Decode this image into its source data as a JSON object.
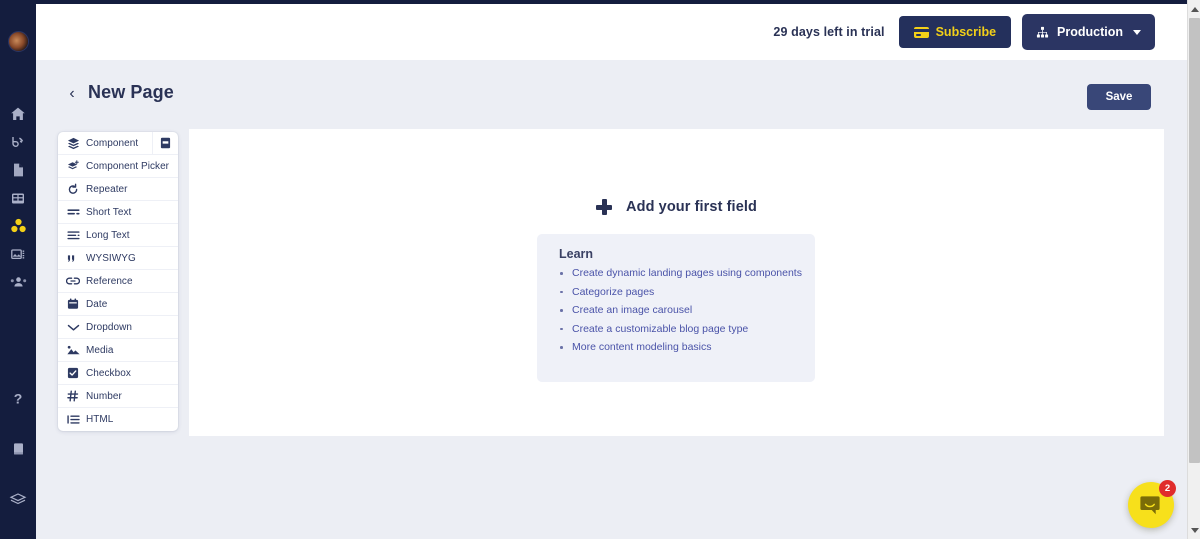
{
  "topbar": {
    "trial_text": "29 days left in trial",
    "subscribe_label": "Subscribe",
    "environment_label": "Production"
  },
  "page_header": {
    "back_label": "‹",
    "title": "New Page",
    "save_label": "Save"
  },
  "field_types": {
    "library_button_title": "Component library",
    "items": [
      {
        "label": "Component",
        "icon": "layers-icon"
      },
      {
        "label": "Component Picker",
        "icon": "layers-plus-icon"
      },
      {
        "label": "Repeater",
        "icon": "refresh-icon"
      },
      {
        "label": "Short Text",
        "icon": "short-text-icon"
      },
      {
        "label": "Long Text",
        "icon": "long-text-icon"
      },
      {
        "label": "WYSIWYG",
        "icon": "quote-icon"
      },
      {
        "label": "Reference",
        "icon": "link-icon"
      },
      {
        "label": "Date",
        "icon": "calendar-icon"
      },
      {
        "label": "Dropdown",
        "icon": "chevron-down-icon"
      },
      {
        "label": "Media",
        "icon": "image-icon"
      },
      {
        "label": "Checkbox",
        "icon": "checkbox-icon"
      },
      {
        "label": "Number",
        "icon": "hash-icon"
      },
      {
        "label": "HTML",
        "icon": "list-icon"
      }
    ]
  },
  "main": {
    "add_first_field_label": "Add your first field",
    "learn": {
      "title": "Learn",
      "links": [
        "Create dynamic landing pages using components",
        "Categorize pages",
        "Create an image carousel",
        "Create a customizable blog page type",
        "More content modeling basics"
      ]
    }
  },
  "chat": {
    "unread_count": "2"
  },
  "rail": {
    "items": [
      {
        "icon": "home-icon"
      },
      {
        "icon": "blog-icon"
      },
      {
        "icon": "page-icon"
      },
      {
        "icon": "table-icon"
      },
      {
        "icon": "components-icon"
      },
      {
        "icon": "media-icon"
      },
      {
        "icon": "audience-icon"
      },
      {
        "icon": "help-icon"
      },
      {
        "icon": "book-icon"
      },
      {
        "icon": "stack-icon"
      }
    ]
  },
  "colors": {
    "rail_bg": "#141d3e",
    "accent_yellow": "#f3d018",
    "button_navy": "#2b3563",
    "link_blue": "#4a53a8",
    "page_bg": "#eceef4"
  }
}
